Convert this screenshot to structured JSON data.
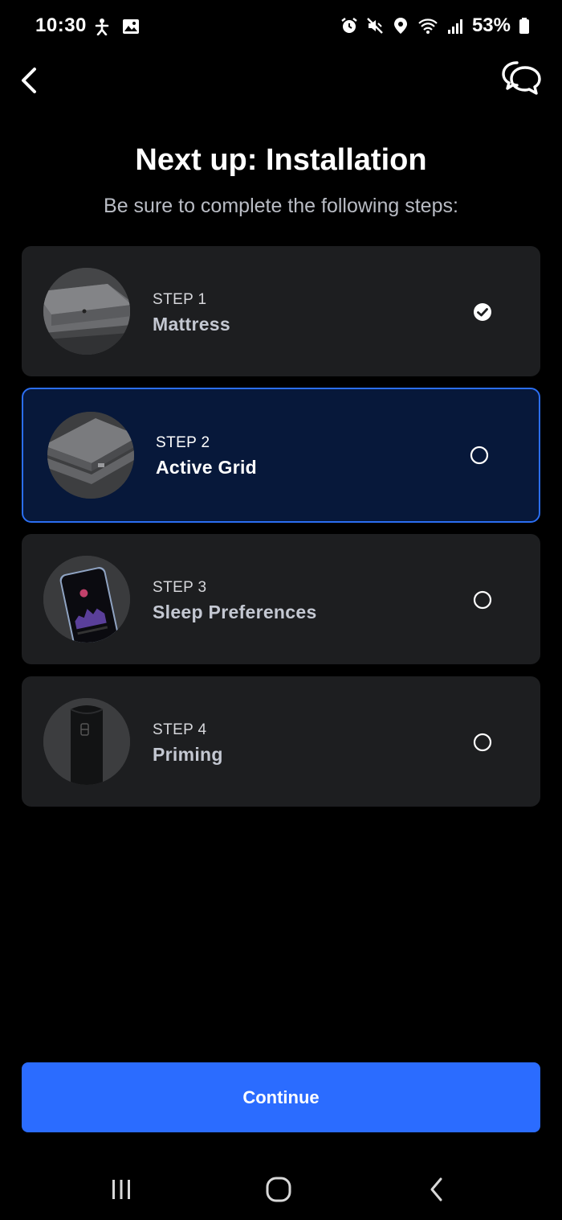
{
  "status_bar": {
    "time": "10:30",
    "battery": "53%",
    "left_icons": [
      "accessibility-icon",
      "image-icon"
    ],
    "right_icons": [
      "alarm-icon",
      "mute-icon",
      "location-icon",
      "wifi-icon",
      "signal-icon",
      "battery-icon"
    ]
  },
  "header": {
    "title": "Next up: Installation",
    "subtitle": "Be sure to complete the following steps:"
  },
  "steps": [
    {
      "label": "STEP 1",
      "name": "Mattress",
      "state": "complete",
      "thumb": "mattress"
    },
    {
      "label": "STEP 2",
      "name": "Active Grid",
      "state": "active",
      "thumb": "active-grid"
    },
    {
      "label": "STEP 3",
      "name": "Sleep Preferences",
      "state": "pending",
      "thumb": "phone"
    },
    {
      "label": "STEP 4",
      "name": "Priming",
      "state": "pending",
      "thumb": "hub"
    }
  ],
  "continue_label": "Continue",
  "colors": {
    "accent": "#2b6cff",
    "active_border": "#2b6ef2",
    "active_bg": "#07183a",
    "card_bg": "#1d1e20"
  }
}
